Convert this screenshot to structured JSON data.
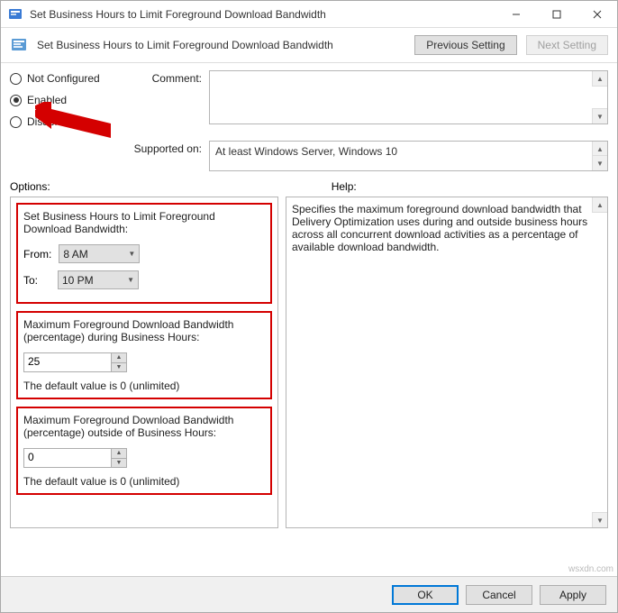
{
  "window": {
    "title": "Set Business Hours to Limit Foreground Download Bandwidth"
  },
  "header": {
    "title": "Set Business Hours to Limit Foreground Download Bandwidth",
    "prev": "Previous Setting",
    "next": "Next Setting"
  },
  "state": {
    "not_configured": "Not Configured",
    "enabled": "Enabled",
    "disabled": "Disabled"
  },
  "labels": {
    "comment": "Comment:",
    "supported": "Supported on:",
    "options": "Options:",
    "help": "Help:"
  },
  "supported_text": "At least Windows Server, Windows 10",
  "options": {
    "block1": {
      "title": "Set Business Hours to Limit Foreground Download Bandwidth:",
      "from_label": "From:",
      "from_value": "8 AM",
      "to_label": "To:",
      "to_value": "10 PM"
    },
    "block2": {
      "title": "Maximum Foreground Download Bandwidth (percentage) during Business Hours:",
      "value": "25",
      "note": "The default value is 0 (unlimited)"
    },
    "block3": {
      "title": "Maximum Foreground Download Bandwidth (percentage) outside of Business Hours:",
      "value": "0",
      "note": "The default value is 0 (unlimited)"
    }
  },
  "help_text": "Specifies the maximum foreground download bandwidth that Delivery Optimization uses during and outside business hours across all concurrent download activities as a percentage of available download bandwidth.",
  "footer": {
    "ok": "OK",
    "cancel": "Cancel",
    "apply": "Apply"
  },
  "watermark": "wsxdn.com"
}
